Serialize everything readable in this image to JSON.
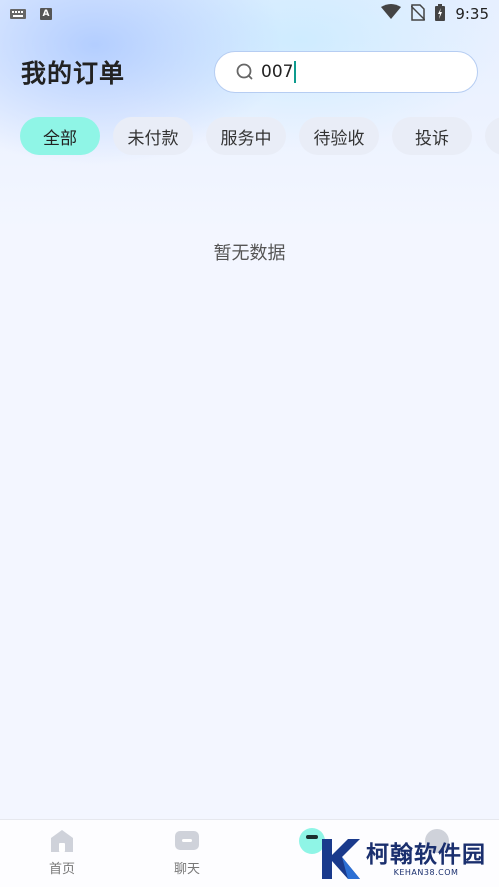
{
  "status_bar": {
    "time": "9:35"
  },
  "header": {
    "title": "我的订单",
    "search_value": "007"
  },
  "tabs": [
    {
      "label": "全部",
      "active": true
    },
    {
      "label": "未付款",
      "active": false
    },
    {
      "label": "服务中",
      "active": false
    },
    {
      "label": "待验收",
      "active": false
    },
    {
      "label": "投诉",
      "active": false
    }
  ],
  "empty_message": "暂无数据",
  "bottom_nav": {
    "items": [
      {
        "label": "首页",
        "icon": "home-icon"
      },
      {
        "label": "聊天",
        "icon": "chat-icon"
      },
      {
        "label": "",
        "icon": "orders-icon"
      },
      {
        "label": "",
        "icon": "profile-icon"
      }
    ]
  },
  "watermark": {
    "name": "柯翰软件园",
    "domain": "KEHAN38.COM"
  },
  "colors": {
    "accent": "#8ff5e6",
    "caret": "#0e9b8e",
    "tab_bg": "#e9edf7",
    "watermark": "#1a2f6e"
  }
}
